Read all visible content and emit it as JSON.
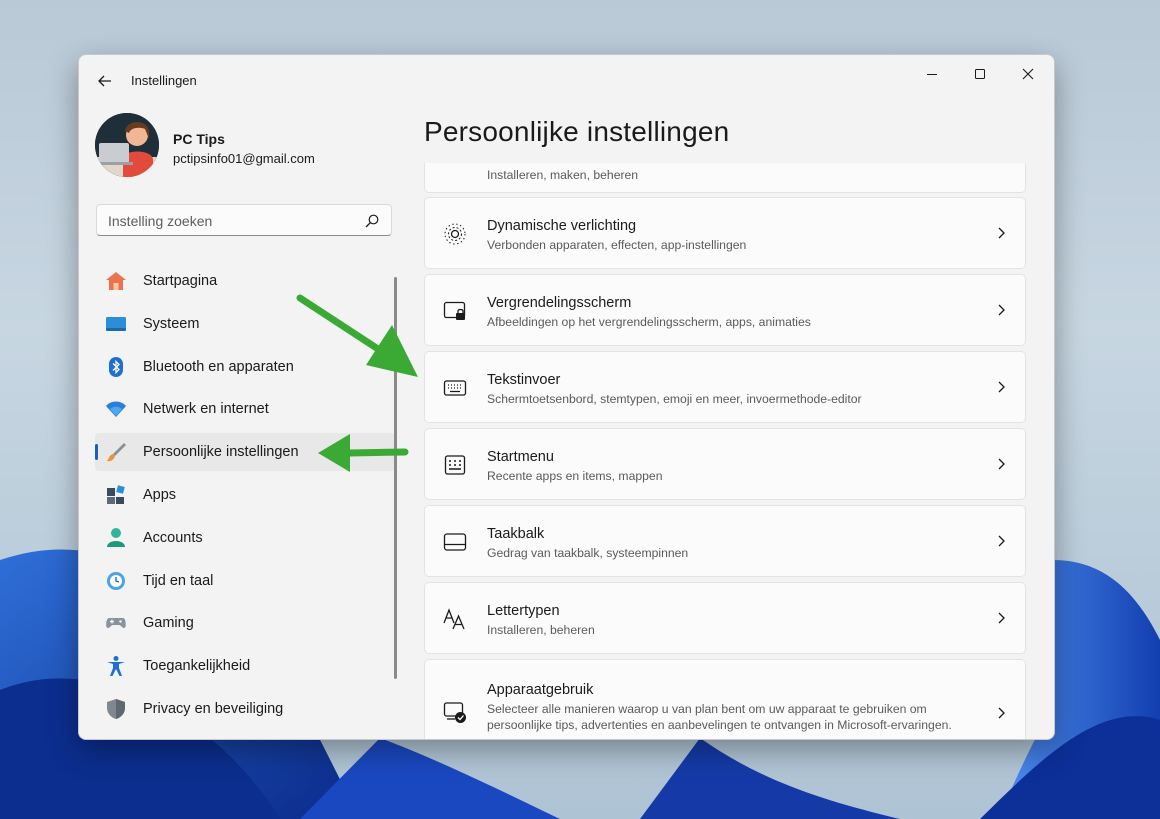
{
  "window": {
    "app_title": "Instellingen",
    "controls": [
      "minimize-icon",
      "maximize-icon",
      "close-icon"
    ]
  },
  "profile": {
    "name": "PC Tips",
    "email": "pctipsinfo01@gmail.com"
  },
  "search": {
    "placeholder": "Instelling zoeken",
    "icon": "search-icon"
  },
  "sidebar": {
    "items": [
      {
        "label": "Startpagina",
        "icon": "home-icon",
        "selected": false
      },
      {
        "label": "Systeem",
        "icon": "system-icon",
        "selected": false
      },
      {
        "label": "Bluetooth en apparaten",
        "icon": "bluetooth-icon",
        "selected": false
      },
      {
        "label": "Netwerk en internet",
        "icon": "wifi-icon",
        "selected": false
      },
      {
        "label": "Persoonlijke instellingen",
        "icon": "paintbrush-icon",
        "selected": true
      },
      {
        "label": "Apps",
        "icon": "apps-icon",
        "selected": false
      },
      {
        "label": "Accounts",
        "icon": "account-icon",
        "selected": false
      },
      {
        "label": "Tijd en taal",
        "icon": "time-language-icon",
        "selected": false
      },
      {
        "label": "Gaming",
        "icon": "gamepad-icon",
        "selected": false
      },
      {
        "label": "Toegankelijkheid",
        "icon": "accessibility-icon",
        "selected": false
      },
      {
        "label": "Privacy en beveiliging",
        "icon": "shield-icon",
        "selected": false
      }
    ]
  },
  "main": {
    "page_title": "Persoonlijke instellingen",
    "cards": [
      {
        "title": "",
        "subtitle": "Installeren, maken, beheren",
        "icon": "theme-icon"
      },
      {
        "title": "Dynamische verlichting",
        "subtitle": "Verbonden apparaten, effecten, app-instellingen",
        "icon": "dynamic-lighting-icon"
      },
      {
        "title": "Vergrendelingsscherm",
        "subtitle": "Afbeeldingen op het vergrendelingsscherm, apps, animaties",
        "icon": "lock-screen-icon"
      },
      {
        "title": "Tekstinvoer",
        "subtitle": "Schermtoetsenbord, stemtypen, emoji en meer, invoermethode-editor",
        "icon": "keyboard-icon"
      },
      {
        "title": "Startmenu",
        "subtitle": "Recente apps en items, mappen",
        "icon": "start-menu-icon"
      },
      {
        "title": "Taakbalk",
        "subtitle": "Gedrag van taakbalk, systeempinnen",
        "icon": "taskbar-icon"
      },
      {
        "title": "Lettertypen",
        "subtitle": "Installeren, beheren",
        "icon": "fonts-icon"
      },
      {
        "title": "Apparaatgebruik",
        "subtitle": "Selecteer alle manieren waarop u van plan bent om uw apparaat te gebruiken om persoonlijke tips, advertenties en aanbevelingen te ontvangen in Microsoft-ervaringen.",
        "icon": "device-usage-icon"
      }
    ]
  },
  "annotations": {
    "arrow_color": "#3aaa35"
  },
  "colors": {
    "accent": "#1d5fb5",
    "window_bg": "#f3f3f3",
    "card_bg": "#fbfbfb"
  }
}
